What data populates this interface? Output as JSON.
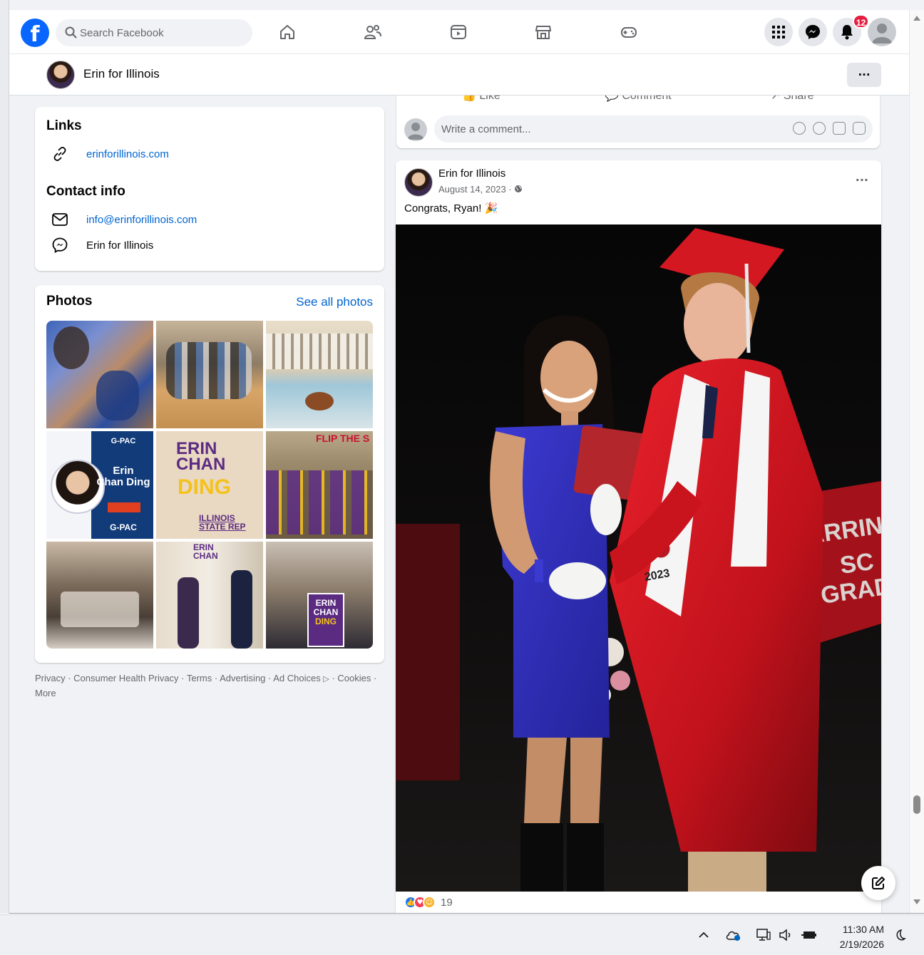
{
  "app": {
    "title": "Facebook"
  },
  "topbar": {
    "search_placeholder": "Search Facebook",
    "nav_icons": [
      "home-icon",
      "friends-icon",
      "video-icon",
      "marketplace-icon",
      "gaming-icon"
    ],
    "notification_count": "12",
    "brand_color": "#0866ff"
  },
  "page": {
    "name": "Erin for Illinois",
    "more": "···"
  },
  "links_card": {
    "heading": "Links",
    "website": "erinforillinois.com",
    "contact_heading": "Contact info",
    "email": "info@erinforillinois.com",
    "messenger": "Erin for Illinois"
  },
  "photos_card": {
    "heading": "Photos",
    "see_all": "See all photos",
    "tiles": [
      {
        "desc": "couple-photo-strip"
      },
      {
        "desc": "group-with-kids"
      },
      {
        "desc": "parade-band"
      },
      {
        "desc": "gpac-endorsement",
        "lines": [
          "G-PAC",
          "Erin",
          "Chan Ding",
          "G-PAC"
        ]
      },
      {
        "desc": "campaign-sign",
        "lines": [
          "ERIN",
          "CHAN",
          "DING",
          "ILLINOIS",
          "STATE REP"
        ]
      },
      {
        "desc": "volunteers-with-signs",
        "lines": [
          "FLIP THE S"
        ]
      },
      {
        "desc": "meeting-table"
      },
      {
        "desc": "campaign-supporters",
        "lines": [
          "ERIN",
          "CHAN"
        ]
      },
      {
        "desc": "selfie-with-sign",
        "lines": [
          "ERIN",
          "CHAN",
          "DING"
        ]
      }
    ]
  },
  "footer": {
    "text": "Privacy · Consumer Health Privacy · Terms · Advertising · Ad Choices",
    "text2": " · Cookies ·",
    "more": "More"
  },
  "prev_post": {
    "actions": [
      "Like",
      "Comment",
      "Share"
    ],
    "comment_placeholder": "Write a comment..."
  },
  "post": {
    "author": "Erin for Illinois",
    "date": "August 14, 2023 ·",
    "text": "Congrats, Ryan! 🎉",
    "photo_caption_text": [
      "ARRING",
      "SC",
      "GRAD",
      "2023"
    ],
    "reaction_count": "19",
    "reaction_colors": [
      "#1877f2",
      "#f33e58",
      "#f7b125"
    ]
  },
  "taskbar": {
    "time": "11:30 AM",
    "date": "2/19/2026"
  }
}
